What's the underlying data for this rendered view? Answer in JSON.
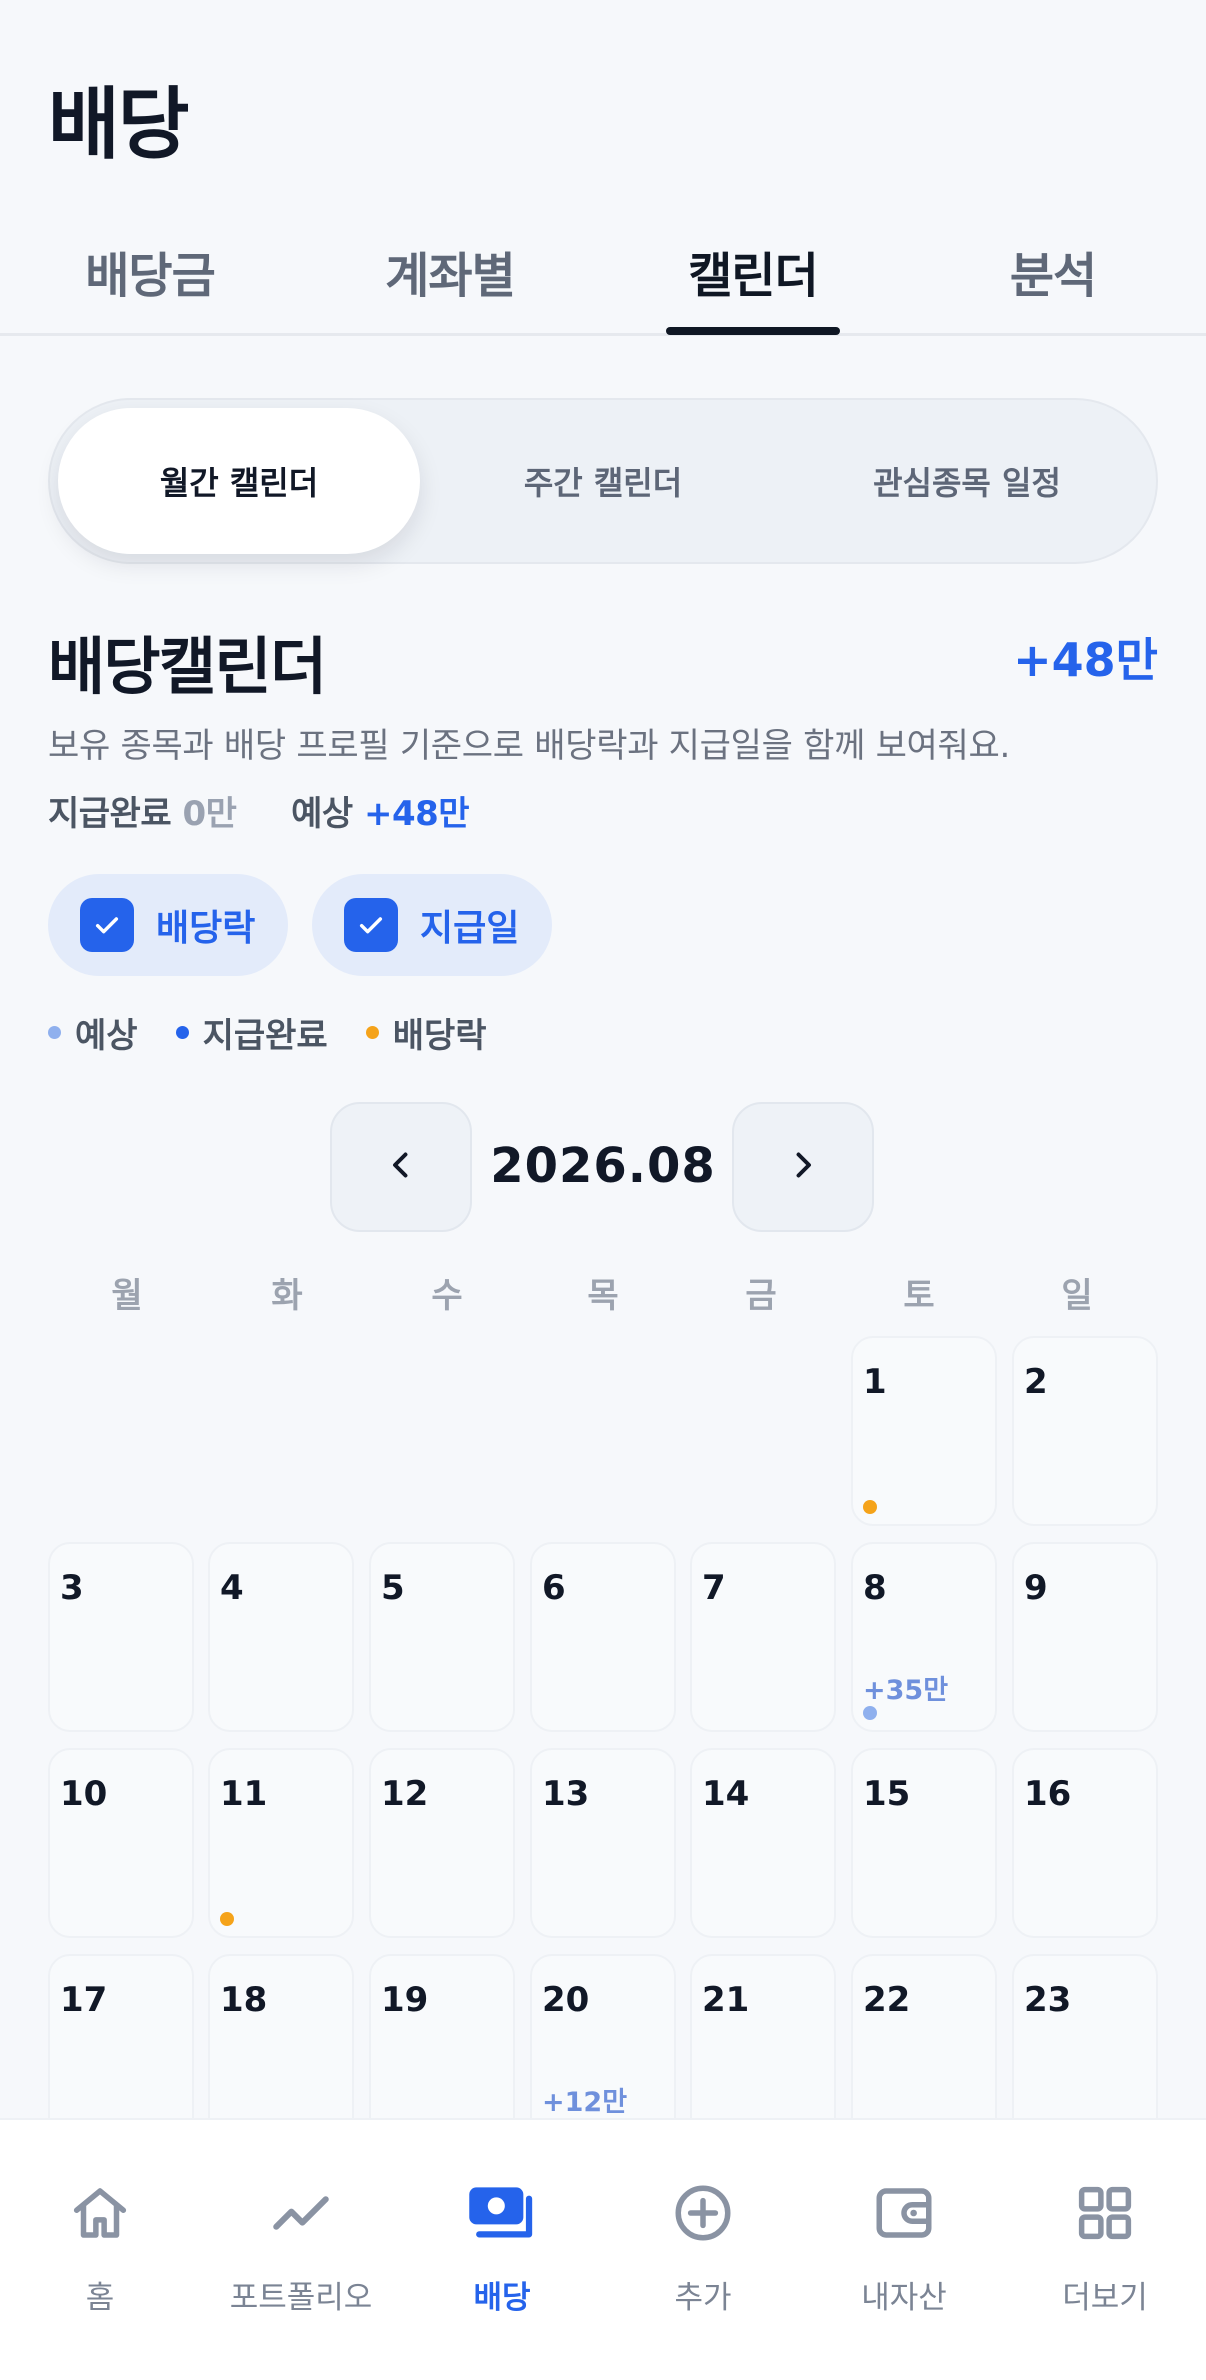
{
  "page": {
    "title": "배당"
  },
  "tabs": [
    {
      "label": "배당금"
    },
    {
      "label": "계좌별"
    },
    {
      "label": "캘린더"
    },
    {
      "label": "분석"
    }
  ],
  "active_tab": "캘린더",
  "segments": [
    {
      "label": "월간 캘린더"
    },
    {
      "label": "주간 캘린더"
    },
    {
      "label": "관심종목 일정"
    }
  ],
  "active_segment": "월간 캘린더",
  "section": {
    "title": "배당캘린더",
    "total": "+48만",
    "description": "보유 종목과 배당 프로필 기준으로 배당락과 지급일을 함께 보여줘요.",
    "paid_label": "지급완료",
    "paid_value": "0만",
    "expected_label": "예상",
    "expected_value": "+48만"
  },
  "filters": [
    {
      "label": "배당락",
      "checked": true
    },
    {
      "label": "지급일",
      "checked": true
    }
  ],
  "legend": [
    {
      "label": "예상",
      "color": "#8fb0ee"
    },
    {
      "label": "지급완료",
      "color": "#2563eb"
    },
    {
      "label": "배당락",
      "color": "#f5a31a"
    }
  ],
  "calendar": {
    "month": "2026.08",
    "weekdays": [
      "월",
      "화",
      "수",
      "목",
      "금",
      "토",
      "일"
    ],
    "days": [
      {
        "day": "1",
        "marker": "#f5a31a"
      },
      {
        "day": "2"
      },
      {
        "day": "3"
      },
      {
        "day": "4"
      },
      {
        "day": "5"
      },
      {
        "day": "6"
      },
      {
        "day": "7"
      },
      {
        "day": "8",
        "amount": "+35만",
        "marker": "#8fb0ee"
      },
      {
        "day": "9"
      },
      {
        "day": "10"
      },
      {
        "day": "11",
        "marker": "#f5a31a"
      },
      {
        "day": "12"
      },
      {
        "day": "13"
      },
      {
        "day": "14"
      },
      {
        "day": "15"
      },
      {
        "day": "16"
      },
      {
        "day": "17"
      },
      {
        "day": "18"
      },
      {
        "day": "19"
      },
      {
        "day": "20",
        "amount": "+12만",
        "marker": "#8fb0ee"
      },
      {
        "day": "21"
      },
      {
        "day": "22"
      },
      {
        "day": "23"
      }
    ]
  },
  "bottom_nav": [
    {
      "label": "홈",
      "icon": "home-icon"
    },
    {
      "label": "포트폴리오",
      "icon": "trend-icon"
    },
    {
      "label": "배당",
      "icon": "dividend-icon",
      "active": true
    },
    {
      "label": "추가",
      "icon": "add-icon"
    },
    {
      "label": "내자산",
      "icon": "wallet-icon"
    },
    {
      "label": "더보기",
      "icon": "grid-icon"
    }
  ],
  "colors": {
    "accent": "#2563eb",
    "text": "#111827",
    "muted": "#7b8494",
    "ex_dividend": "#f5a31a",
    "expected": "#8fb0ee"
  }
}
